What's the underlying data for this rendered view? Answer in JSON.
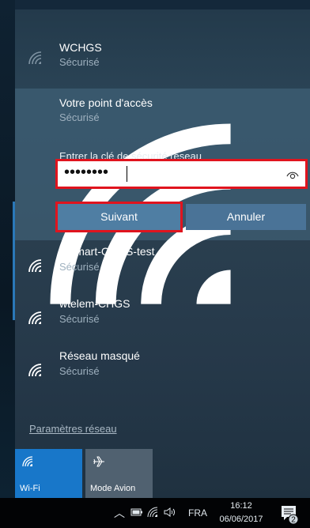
{
  "networks": {
    "top": {
      "name": "WCHGS",
      "status": "Sécurisé"
    },
    "selected": {
      "name": "Votre point d'accès",
      "status": "Sécurisé"
    },
    "list": [
      {
        "name": "wismart-CHGS-test",
        "status": "Sécurisé"
      },
      {
        "name": "wtelem-CHGS",
        "status": "Sécurisé"
      },
      {
        "name": "Réseau masqué",
        "status": "Sécurisé"
      }
    ]
  },
  "security_key": {
    "label": "Entrer la clé de sécurité réseau",
    "value": "••••••••"
  },
  "buttons": {
    "next": "Suivant",
    "cancel": "Annuler"
  },
  "settings_link": "Paramètres réseau",
  "quick_actions": [
    {
      "label": "Wi-Fi",
      "icon": "wifi-icon",
      "active": true
    },
    {
      "label": "Mode Avion",
      "icon": "airplane-icon",
      "active": false
    }
  ],
  "taskbar": {
    "language": "FRA",
    "time": "16:12",
    "date": "06/06/2017",
    "notification_count": "2"
  },
  "colors": {
    "highlight_outline": "#e0141e",
    "accent_blue": "#1877c9",
    "button": "#4f7ea3"
  }
}
